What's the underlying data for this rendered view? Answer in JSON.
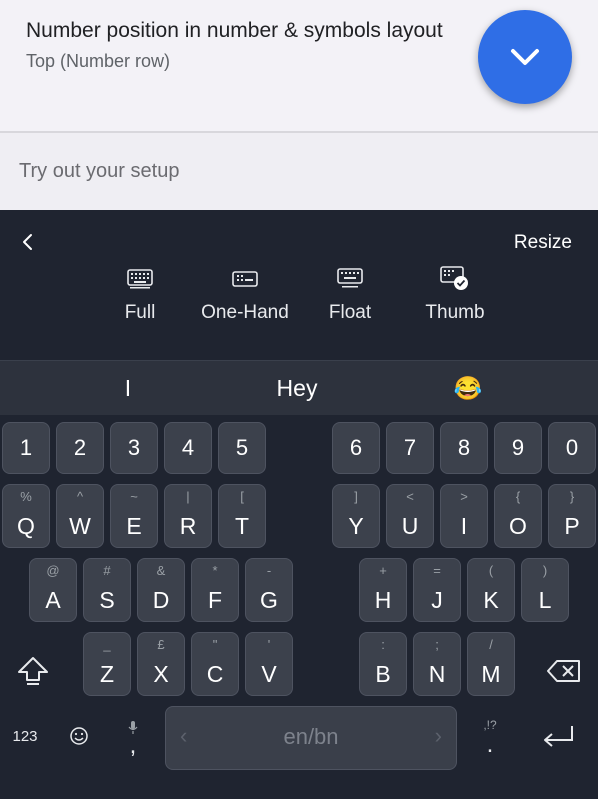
{
  "setting": {
    "title": "Number position in number & symbols layout",
    "value": "Top (Number row)"
  },
  "fab": {
    "icon": "chevron-down-icon",
    "color": "#2f6ee6"
  },
  "try_input": {
    "placeholder": "Try out your setup"
  },
  "toolbar": {
    "resize_label": "Resize",
    "modes": [
      {
        "label": "Full",
        "icon": "keyboard-full-icon"
      },
      {
        "label": "One-Hand",
        "icon": "keyboard-one-hand-icon"
      },
      {
        "label": "Float",
        "icon": "keyboard-float-icon"
      },
      {
        "label": "Thumb",
        "icon": "keyboard-thumb-icon",
        "selected": true
      }
    ]
  },
  "suggestions": [
    "I",
    "Hey",
    "😂"
  ],
  "keyboard": {
    "number_row": [
      "1",
      "2",
      "3",
      "4",
      "5",
      "6",
      "7",
      "8",
      "9",
      "0"
    ],
    "row1": [
      {
        "main": "Q",
        "hint": "%"
      },
      {
        "main": "W",
        "hint": "^"
      },
      {
        "main": "E",
        "hint": "~"
      },
      {
        "main": "R",
        "hint": "|"
      },
      {
        "main": "T",
        "hint": "["
      },
      {
        "main": "Y",
        "hint": "]"
      },
      {
        "main": "U",
        "hint": "<"
      },
      {
        "main": "I",
        "hint": ">"
      },
      {
        "main": "O",
        "hint": "{"
      },
      {
        "main": "P",
        "hint": "}"
      }
    ],
    "row2": [
      {
        "main": "A",
        "hint": "@"
      },
      {
        "main": "S",
        "hint": "#"
      },
      {
        "main": "D",
        "hint": "&"
      },
      {
        "main": "F",
        "hint": "*"
      },
      {
        "main": "G",
        "hint": "-"
      },
      {
        "main": "H",
        "hint": "+"
      },
      {
        "main": "J",
        "hint": "="
      },
      {
        "main": "K",
        "hint": "("
      },
      {
        "main": "L",
        "hint": ")"
      }
    ],
    "row3": [
      {
        "main": "Z",
        "hint": "_"
      },
      {
        "main": "X",
        "hint": "£"
      },
      {
        "main": "C",
        "hint": "\""
      },
      {
        "main": "V",
        "hint": "'"
      },
      {
        "main": "B",
        "hint": ":"
      },
      {
        "main": "N",
        "hint": ";"
      },
      {
        "main": "M",
        "hint": "/"
      }
    ],
    "bottom": {
      "symbols_label": "123",
      "comma": ",",
      "space_label": "en/bn",
      "period": ".",
      "period_hint": ",!?"
    }
  }
}
